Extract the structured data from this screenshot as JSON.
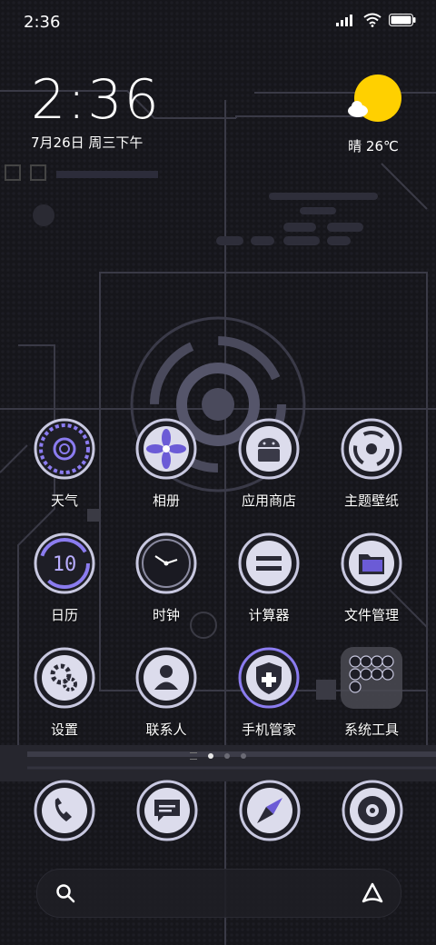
{
  "status_bar": {
    "time": "2:36"
  },
  "clock": {
    "time": "2:36",
    "date": "7月26日 周三下午"
  },
  "weather": {
    "text": "晴 26℃"
  },
  "apps": [
    {
      "label": "天气",
      "icon": "weather-icon"
    },
    {
      "label": "相册",
      "icon": "gallery-icon"
    },
    {
      "label": "应用商店",
      "icon": "app-store-icon"
    },
    {
      "label": "主题壁纸",
      "icon": "themes-icon"
    },
    {
      "label": "日历",
      "icon": "calendar-icon"
    },
    {
      "label": "时钟",
      "icon": "clock-icon"
    },
    {
      "label": "计算器",
      "icon": "calculator-icon"
    },
    {
      "label": "文件管理",
      "icon": "file-manager-icon"
    },
    {
      "label": "设置",
      "icon": "settings-icon"
    },
    {
      "label": "联系人",
      "icon": "contacts-icon"
    },
    {
      "label": "手机管家",
      "icon": "security-icon"
    },
    {
      "label": "系统工具",
      "icon": "system-tools-folder-icon"
    }
  ],
  "calendar_digit": "10",
  "page_indicator": {
    "pages": 3,
    "active": 1
  },
  "dock": [
    {
      "icon": "phone-icon"
    },
    {
      "icon": "messages-icon"
    },
    {
      "icon": "browser-compass-icon"
    },
    {
      "icon": "camera-icon"
    }
  ],
  "colors": {
    "accent": "#8b7cf0",
    "sun": "#ffd000",
    "ring": "#c8c8e0"
  }
}
